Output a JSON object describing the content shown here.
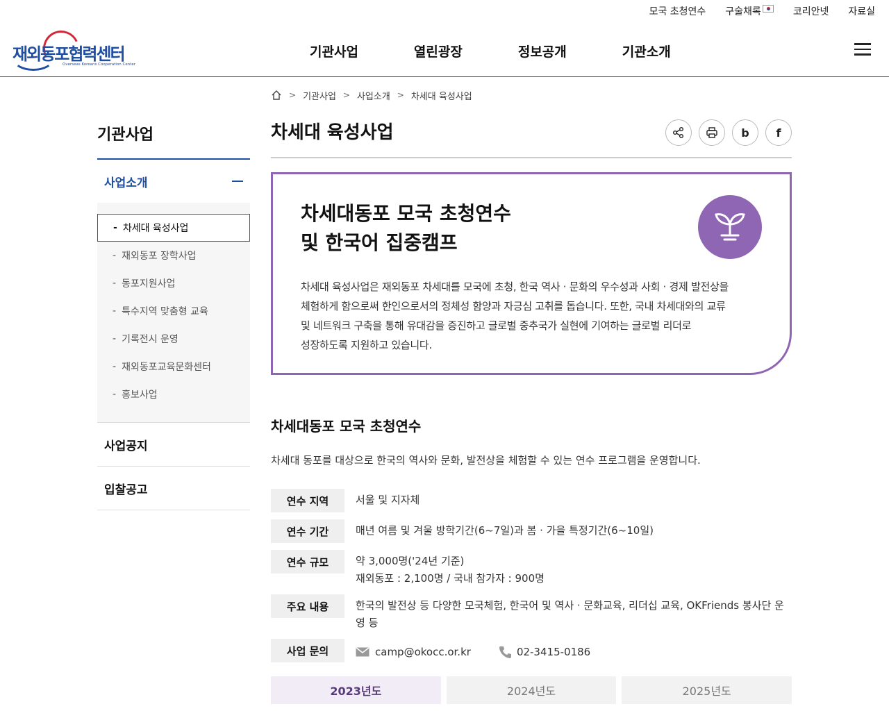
{
  "utility": {
    "links": [
      "모국 초청연수",
      "구술채록",
      "코리안넷",
      "자료실"
    ]
  },
  "logo": {
    "name": "재외동포협력센터",
    "subtitle": "Overseas Koreans Cooperation Center"
  },
  "gnb": [
    "기관사업",
    "열린광장",
    "정보공개",
    "기관소개"
  ],
  "sidebar": {
    "title": "기관사업",
    "group": "사업소개",
    "items": [
      "차세대 육성사업",
      "재외동포 장학사업",
      "동포지원사업",
      "특수지역 맞춤형 교육",
      "기록전시 운영",
      "재외동포교육문화센터",
      "홍보사업"
    ],
    "active_index": 0,
    "other": [
      "사업공지",
      "입찰공고"
    ]
  },
  "breadcrumb": [
    "기관사업",
    "사업소개",
    "차세대 육성사업"
  ],
  "page_title": "차세대 육성사업",
  "tools": {
    "share": "share-icon",
    "print": "print-icon",
    "blog": "b",
    "facebook": "f"
  },
  "intro": {
    "title_line1": "차세대동포 모국 초청연수",
    "title_line2": "및 한국어 집중캠프",
    "desc_lines": [
      "차세대 육성사업은 재외동포 차세대를 모국에 초청, 한국 역사 · 문화의 우수성과 사회 · 경제 발전상을",
      "체험하게 함으로써 한인으로서의 정체성 함양과 자긍심 고취를 돕습니다. 또한, 국내 차세대와의 교류",
      "및 네트워크 구축을 통해 유대감을 증진하고 글로벌 중추국가 실현에 기여하는 글로벌 리더로",
      "성장하도록 지원하고 있습니다."
    ],
    "icon_color": "#8f66b3"
  },
  "section": {
    "title": "차세대동포 모국 초청연수",
    "desc": "차세대 동포를 대상으로 한국의 역사와 문화, 발전상을 체험할 수 있는 연수 프로그램을 운영합니다."
  },
  "info": {
    "region_label": "연수 지역",
    "region_value": "서울 및 지자체",
    "period_label": "연수 기간",
    "period_value": "매년 여름 및 겨울 방학기간(6~7일)과 봄 · 가을 특정기간(6~10일)",
    "scale_label": "연수 규모",
    "scale_value1": "약 3,000명('24년 기준)",
    "scale_value2": "재외동포 : 2,100명 / 국내 참가자 : 900명",
    "content_label": "주요 내용",
    "content_value": "한국의 발전상 등 다양한 모국체험, 한국어 및 역사 · 문화교육, 리더십 교육, OKFriends 봉사단 운영 등",
    "contact_label": "사업 문의",
    "email": "camp@okocc.or.kr",
    "phone": "02-3415-0186"
  },
  "years": [
    "2023년도",
    "2024년도",
    "2025년도"
  ],
  "active_year_index": 0,
  "colors": {
    "accent": "#8e65b3",
    "brand": "#1f4fa3"
  }
}
